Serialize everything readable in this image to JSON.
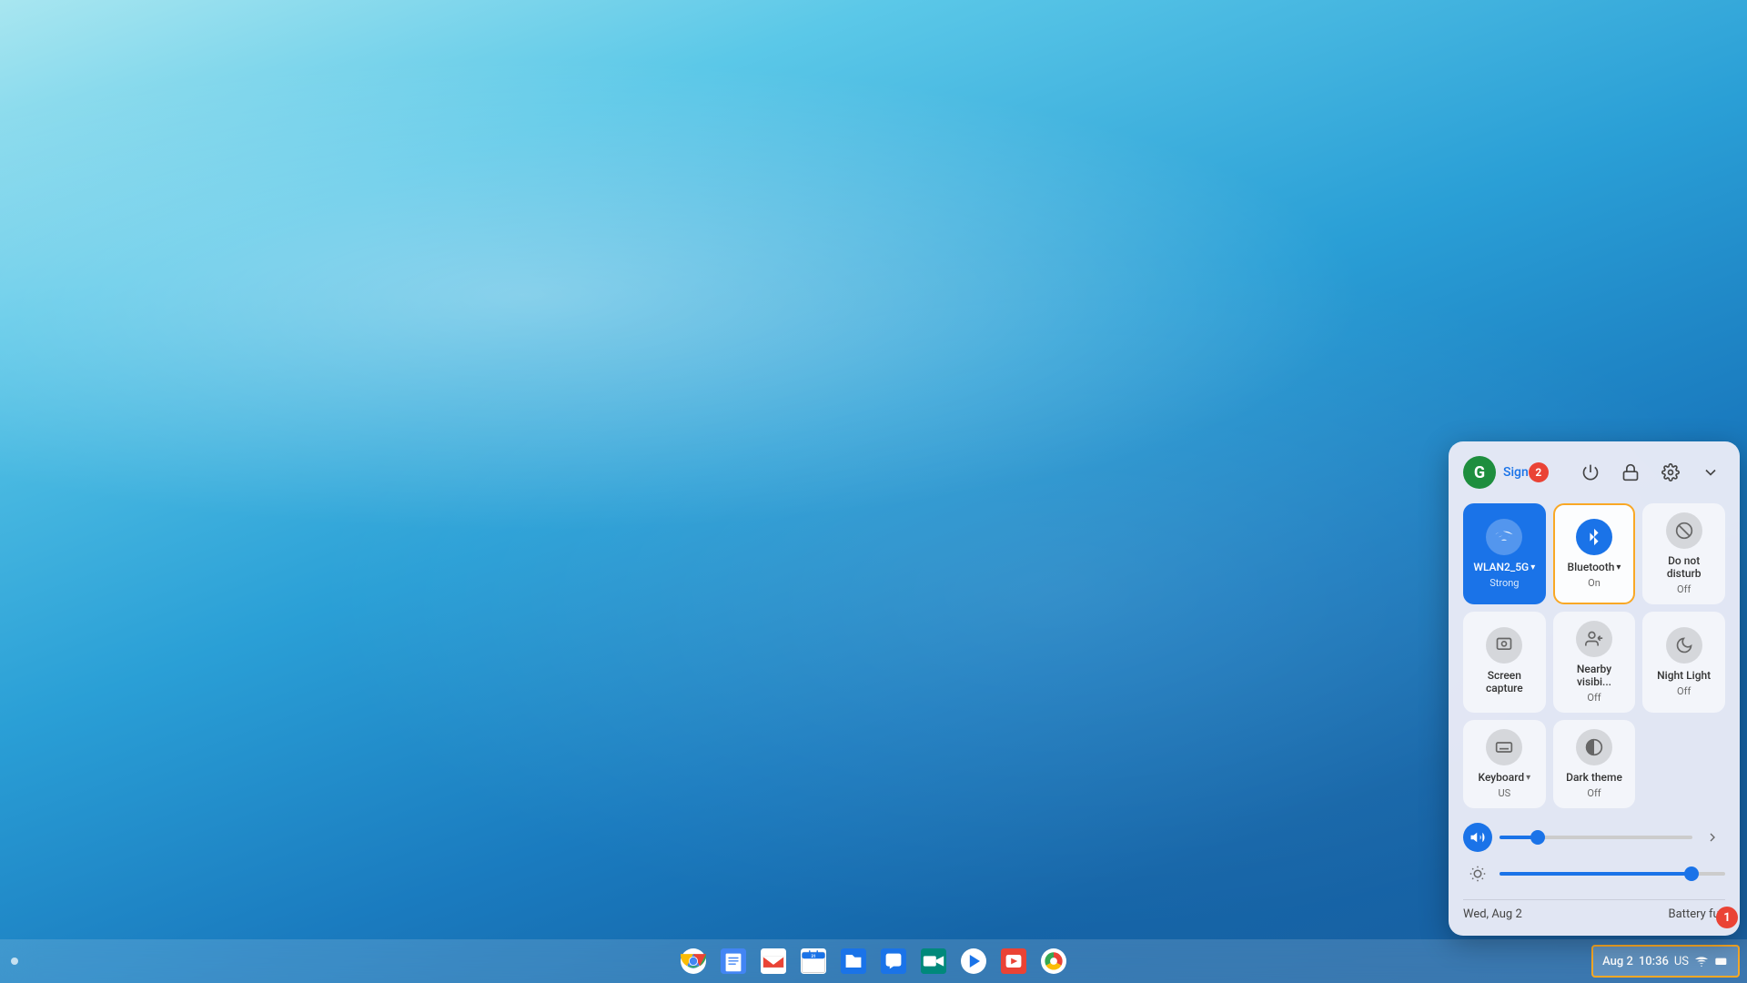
{
  "desktop": {
    "background": "chromebook-blue-wave"
  },
  "taskbar": {
    "left_dot_label": "•",
    "apps": [
      {
        "name": "Chrome",
        "icon": "chrome",
        "color": "#fff"
      },
      {
        "name": "Docs",
        "icon": "docs",
        "color": "#4285f4"
      },
      {
        "name": "Gmail",
        "icon": "gmail",
        "color": "#ea4335"
      },
      {
        "name": "Calendar",
        "icon": "calendar",
        "color": "#1a73e8"
      },
      {
        "name": "Files",
        "icon": "files",
        "color": "#1a73e8"
      },
      {
        "name": "Chat",
        "icon": "chat",
        "color": "#1a73e8"
      },
      {
        "name": "Meet",
        "icon": "meet",
        "color": "#1a73e8"
      },
      {
        "name": "Play",
        "icon": "play",
        "color": "#ea4335"
      },
      {
        "name": "YouTube",
        "icon": "youtube",
        "color": "#ea4335"
      },
      {
        "name": "Photos",
        "icon": "photos",
        "color": "#ea4335"
      }
    ],
    "system_tray": {
      "date": "Aug 2",
      "time": "10:36",
      "locale": "US",
      "wifi_connected": true,
      "battery_full": true
    }
  },
  "quick_settings": {
    "avatar_letter": "G",
    "sign_text": "Sign",
    "notification_count": "2",
    "header_icons": [
      {
        "name": "power",
        "symbol": "⏻"
      },
      {
        "name": "lock",
        "symbol": "🔒"
      },
      {
        "name": "settings",
        "symbol": "⚙"
      },
      {
        "name": "expand",
        "symbol": "∨"
      }
    ],
    "tiles": [
      {
        "id": "wifi",
        "label": "WLAN2_5G",
        "status": "Strong",
        "active": true,
        "has_arrow": true,
        "icon_type": "wifi"
      },
      {
        "id": "bluetooth",
        "label": "Bluetooth",
        "status": "On",
        "active": true,
        "selected": true,
        "has_arrow": true,
        "icon_type": "bluetooth"
      },
      {
        "id": "donotdisturb",
        "label": "Do not disturb",
        "status": "Off",
        "active": false,
        "icon_type": "donotdisturb"
      },
      {
        "id": "screencapture",
        "label": "Screen capture",
        "status": "",
        "active": false,
        "icon_type": "screencapture"
      },
      {
        "id": "nearbyshare",
        "label": "Nearby visibi...",
        "status": "Off",
        "active": false,
        "icon_type": "nearbyshare"
      },
      {
        "id": "nightlight",
        "label": "Night Light",
        "status": "Off",
        "active": false,
        "icon_type": "nightlight"
      },
      {
        "id": "keyboard",
        "label": "Keyboard",
        "status": "US",
        "active": false,
        "has_arrow": true,
        "icon_type": "keyboard"
      },
      {
        "id": "darktheme",
        "label": "Dark theme",
        "status": "Off",
        "active": false,
        "icon_type": "darktheme"
      }
    ],
    "volume": {
      "level": 20,
      "icon": "volume"
    },
    "brightness": {
      "level": 85,
      "icon": "brightness"
    },
    "footer": {
      "date": "Wed, Aug 2",
      "battery_status": "Battery full"
    }
  },
  "badges": {
    "badge1": "1",
    "badge2": "2"
  }
}
